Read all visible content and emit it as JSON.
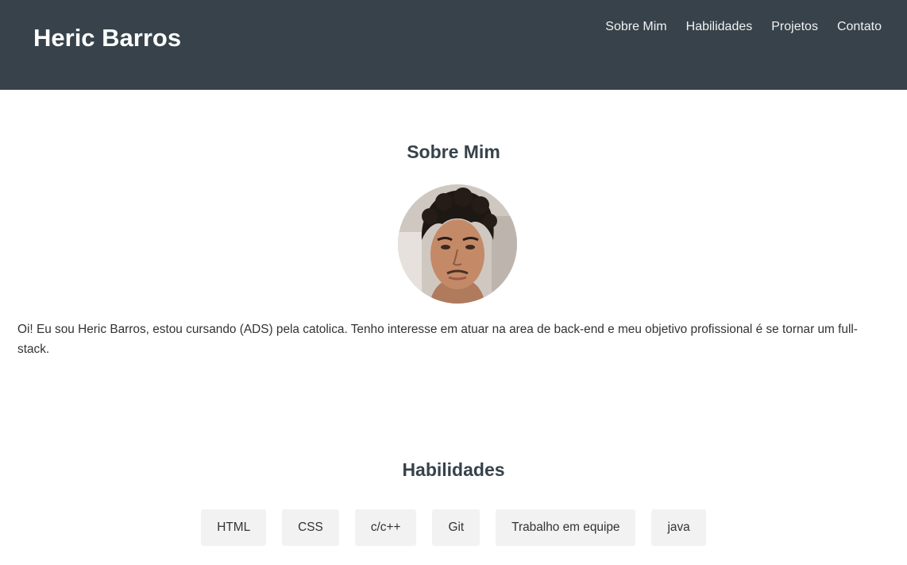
{
  "header": {
    "brand": "Heric Barros",
    "nav": [
      "Sobre Mim",
      "Habilidades",
      "Projetos",
      "Contato"
    ]
  },
  "about": {
    "title": "Sobre Mim",
    "text": "Oi! Eu sou Heric Barros, estou cursando (ADS) pela catolica. Tenho interesse em atuar na area de back-end e meu objetivo profissional é se tornar um full-stack."
  },
  "skills": {
    "title": "Habilidades",
    "items": [
      "HTML",
      "CSS",
      "c/c++",
      "Git",
      "Trabalho em equipe",
      "java"
    ]
  },
  "colors": {
    "header_bg": "#37424a",
    "title": "#37424a",
    "skill_bg": "#f2f2f2"
  }
}
